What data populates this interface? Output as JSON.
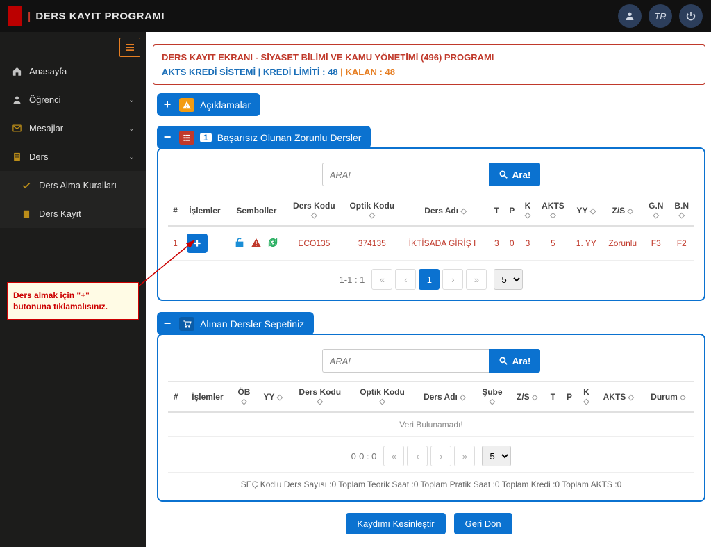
{
  "app": {
    "title": "DERS KAYIT PROGRAMI"
  },
  "top": {
    "lang": "TR"
  },
  "sidebar": {
    "items": [
      {
        "icon": "home",
        "label": "Anasayfa",
        "expandable": false
      },
      {
        "icon": "user",
        "label": "Öğrenci",
        "expandable": true
      },
      {
        "icon": "mail",
        "label": "Mesajlar",
        "expandable": true
      },
      {
        "icon": "doc",
        "label": "Ders",
        "expandable": true
      }
    ],
    "subitems": [
      {
        "icon": "check",
        "label": "Ders Alma Kuralları"
      },
      {
        "icon": "doc",
        "label": "Ders Kayıt"
      }
    ]
  },
  "callout": {
    "line1": "Ders almak için \"+\"",
    "line2": "butonuna tıklamalısınız."
  },
  "banner": {
    "left": "DERS KAYIT EKRANI - SİYASET BİLİMİ VE KAMU YÖNETİMİ (496) PROGRAMI",
    "right_prefix": "AKTS KREDİ SİSTEMİ | KREDİ LİMİTİ : ",
    "limit": "48",
    "sep": " | ",
    "kalan_label": "KALAN : ",
    "kalan": "48"
  },
  "sections": {
    "aciklamalar": {
      "title": "Açıklamalar"
    },
    "basarisiz": {
      "title": "Başarısız Olunan Zorunlu Dersler",
      "badge": "1",
      "search_placeholder": "ARA!",
      "search_button": "Ara!",
      "headers": {
        "num": "#",
        "islemler": "İşlemler",
        "semboller": "Semboller",
        "kod": "Ders Kodu",
        "optik": "Optik Kodu",
        "ad": "Ders Adı",
        "t": "T",
        "p": "P",
        "k": "K",
        "akts": "AKTS",
        "yy": "YY",
        "zs": "Z/S",
        "gn": "G.N",
        "bn": "B.N"
      },
      "row": {
        "num": "1",
        "kod": "ECO135",
        "optik": "374135",
        "ad": "İKTİSADA GİRİŞ I",
        "t": "3",
        "p": "0",
        "k": "3",
        "akts": "5",
        "yy": "1. YY",
        "zs": "Zorunlu",
        "gn": "F3",
        "bn": "F2"
      },
      "pager": {
        "info": "1-1 : 1",
        "page": "1",
        "size": "5"
      }
    },
    "sepet": {
      "title": "Alınan Dersler Sepetiniz",
      "search_placeholder": "ARA!",
      "search_button": "Ara!",
      "headers": {
        "num": "#",
        "islemler": "İşlemler",
        "ob": "ÖB",
        "yy": "YY",
        "kod": "Ders Kodu",
        "optik": "Optik Kodu",
        "ad": "Ders Adı",
        "sube": "Şube",
        "zs": "Z/S",
        "t": "T",
        "p": "P",
        "k": "K",
        "akts": "AKTS",
        "durum": "Durum"
      },
      "empty": "Veri Bulunamadı!",
      "pager": {
        "info": "0-0 : 0",
        "size": "5"
      },
      "summary": "SEÇ Kodlu Ders Sayısı :0 Toplam Teorik Saat :0 Toplam Pratik Saat :0 Toplam Kredi :0 Toplam AKTS :0"
    }
  },
  "actions": {
    "save": "Kaydımı Kesinleştir",
    "back": "Geri Dön"
  }
}
